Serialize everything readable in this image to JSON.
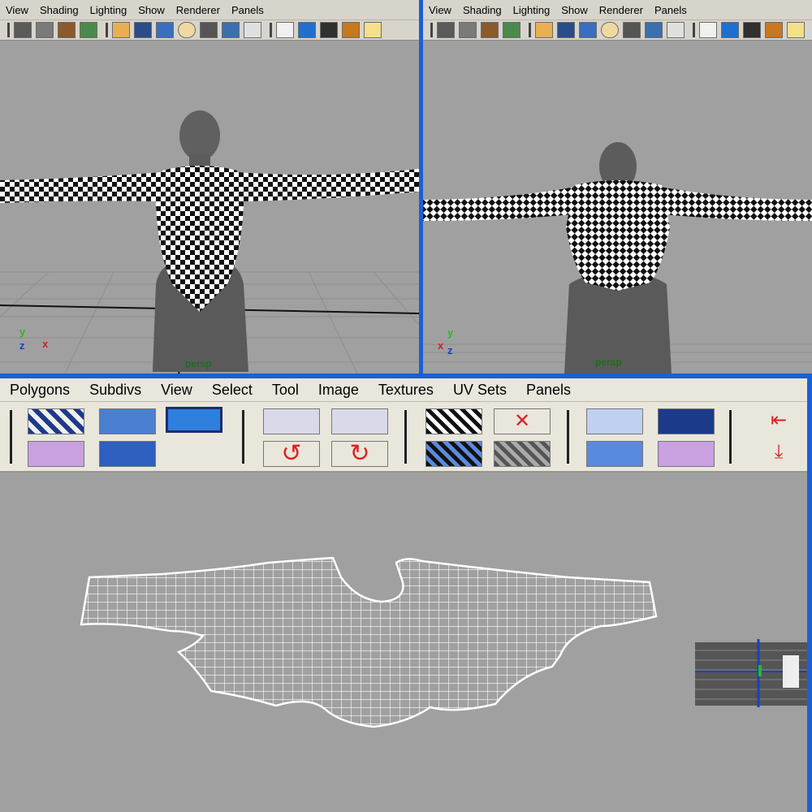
{
  "viewports": [
    {
      "menu": [
        "View",
        "Shading",
        "Lighting",
        "Show",
        "Renderer",
        "Panels"
      ],
      "camera_label": "persp",
      "axis": {
        "y": "y",
        "x": "x",
        "z": "z"
      }
    },
    {
      "menu": [
        "View",
        "Shading",
        "Lighting",
        "Show",
        "Renderer",
        "Panels"
      ],
      "camera_label": "persp",
      "axis": {
        "y": "y",
        "x": "x",
        "z": "z"
      }
    }
  ],
  "toolbar_icons": [
    "camera-icon",
    "camera-attributes-icon",
    "bookmark-icon",
    "image-plane-icon",
    "grid-icon",
    "film-gate-icon",
    "resolution-gate-icon",
    "safe-action-icon",
    "field-chart-icon",
    "texture-icon",
    "text-icon",
    "wireframe-icon",
    "smooth-shade-icon",
    "flat-shade-icon",
    "textured-icon",
    "light-icon"
  ],
  "uv_editor": {
    "menu": [
      "Polygons",
      "Subdivs",
      "View",
      "Select",
      "Tool",
      "Image",
      "Textures",
      "UV Sets",
      "Panels"
    ],
    "tool_icons": [
      "uv-checker-icon",
      "uv-move-icon",
      "uv-snapshot-icon",
      "uv-select-icon",
      "uv-lattice-icon",
      "flip-uv-h-icon",
      "flip-uv-v-icon",
      "rotate-uv-ccw-icon",
      "rotate-uv-cw-icon",
      "cut-uv-icon",
      "sew-uv-icon",
      "merge-uv-icon",
      "unfold-uv-icon",
      "move-sew-icon",
      "layout-uv-icon",
      "isolate-icon",
      "grid-uv-icon",
      "align-left-icon",
      "align-bottom-icon"
    ]
  },
  "colors": {
    "accent": "#1b5fd6",
    "viewport_bg": "#a0a0a0",
    "menu_bg": "#d7d4cc"
  }
}
